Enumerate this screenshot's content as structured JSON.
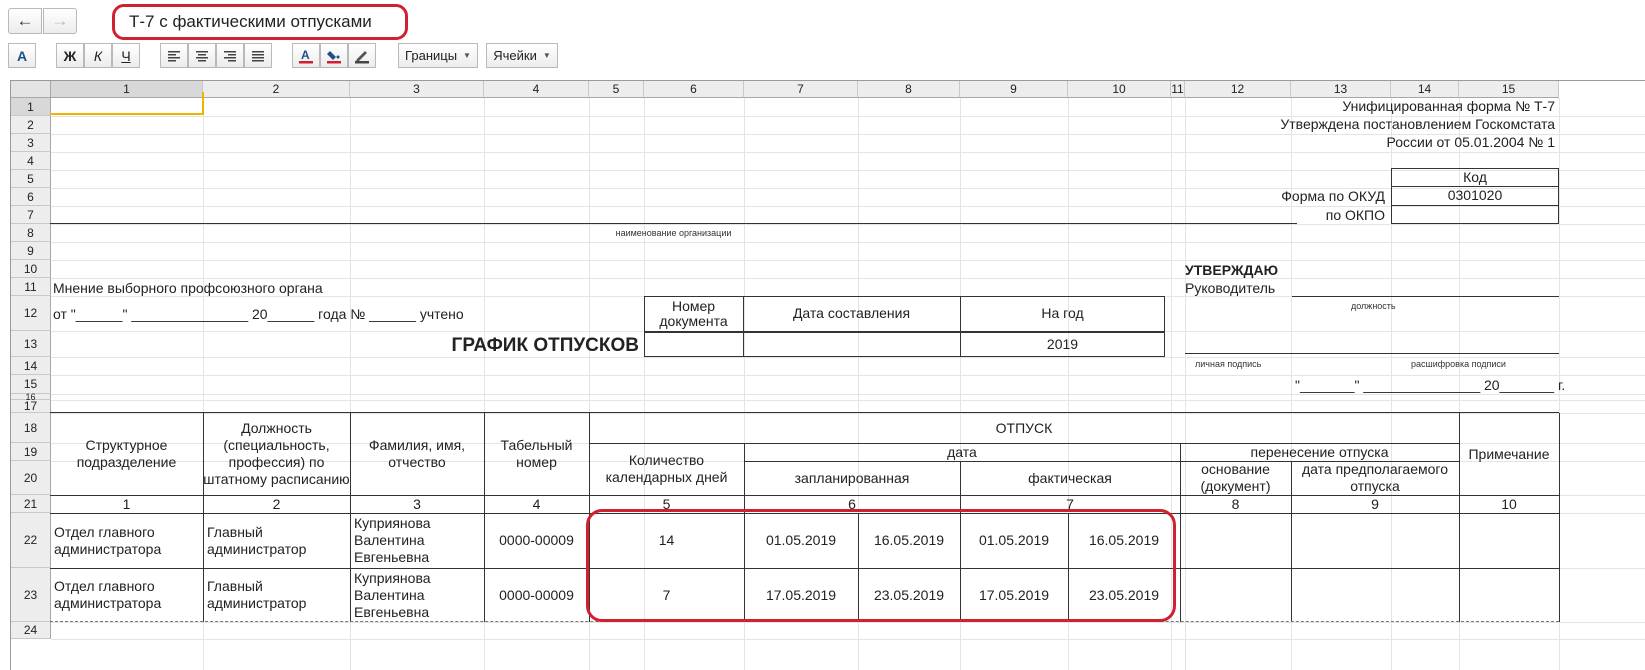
{
  "window": {
    "title": "Т-7 с фактическими отпусками"
  },
  "toolbar": {
    "borders_label": "Границы",
    "cells_label": "Ячейки",
    "bold_label": "Ж",
    "italic_label": "К",
    "underline_label": "Ч",
    "font_label": "A"
  },
  "columns": [
    "1",
    "2",
    "3",
    "4",
    "5",
    "6",
    "7",
    "8",
    "9",
    "10",
    "11",
    "12",
    "13",
    "14",
    "15"
  ],
  "rows": [
    "1",
    "2",
    "3",
    "4",
    "5",
    "6",
    "7",
    "8",
    "9",
    "10",
    "11",
    "12",
    "13",
    "14",
    "15",
    "16",
    "17",
    "18",
    "19",
    "20",
    "21",
    "22",
    "23",
    "24"
  ],
  "header": {
    "form_line1": "Унифицированная форма № Т-7",
    "form_line2": "Утверждена постановлением Госкомстата",
    "form_line3": "России от 05.01.2004 № 1",
    "code_label": "Код",
    "okud_label": "Форма по ОКУД",
    "okud_value": "0301020",
    "okpo_label": "по ОКПО",
    "org_caption": "наименование организации",
    "approve": "УТВЕРЖДАЮ",
    "head_label": "Руководитель",
    "position_caption": "должность",
    "signature_caption": "личная подпись",
    "decode_caption": "расшифровка подписи",
    "date_line": "\"_______\" _______________ 20_______ г.",
    "union_opinion": "Мнение выборного профсоюзного органа",
    "union_line": "от \"______\" _______________ 20______ года № ______ учтено",
    "doc_title": "ГРАФИК ОТПУСКОВ",
    "doc_number_label": "Номер документа",
    "doc_date_label": "Дата составления",
    "year_label": "На год",
    "year_value": "2019"
  },
  "table": {
    "col_dept": "Структурное подразделение",
    "col_position": "Должность (специальность, профессия) по штатному расписанию",
    "col_name": "Фамилия, имя, отчество",
    "col_tab": "Табельный номер",
    "col_vacation": "ОТПУСК",
    "col_days": "Количество календарных дней",
    "col_date": "дата",
    "col_planned": "запланированная",
    "col_actual": "фактическая",
    "col_transfer": "перенесение отпуска",
    "col_basis": "основание (документ)",
    "col_expected": "дата предполагаемого отпуска",
    "col_note": "Примечание",
    "num_row": [
      "1",
      "2",
      "3",
      "4",
      "5",
      "6",
      "7",
      "8",
      "9",
      "10"
    ],
    "data_rows": [
      {
        "dept": "Отдел главного администратора",
        "position": "Главный администратор",
        "name": "Куприянова Валентина Евгеньевна",
        "tab": "0000-00009",
        "days": "14",
        "plan_from": "01.05.2019",
        "plan_to": "16.05.2019",
        "fact_from": "01.05.2019",
        "fact_to": "16.05.2019"
      },
      {
        "dept": "Отдел главного администратора",
        "position": "Главный администратор",
        "name": "Куприянова Валентина Евгеньевна",
        "tab": "0000-00009",
        "days": "7",
        "plan_from": "17.05.2019",
        "plan_to": "23.05.2019",
        "fact_from": "17.05.2019",
        "fact_to": "23.05.2019"
      }
    ]
  },
  "colors": {
    "highlight": "#d0222e",
    "header_bg": "#ededed"
  }
}
